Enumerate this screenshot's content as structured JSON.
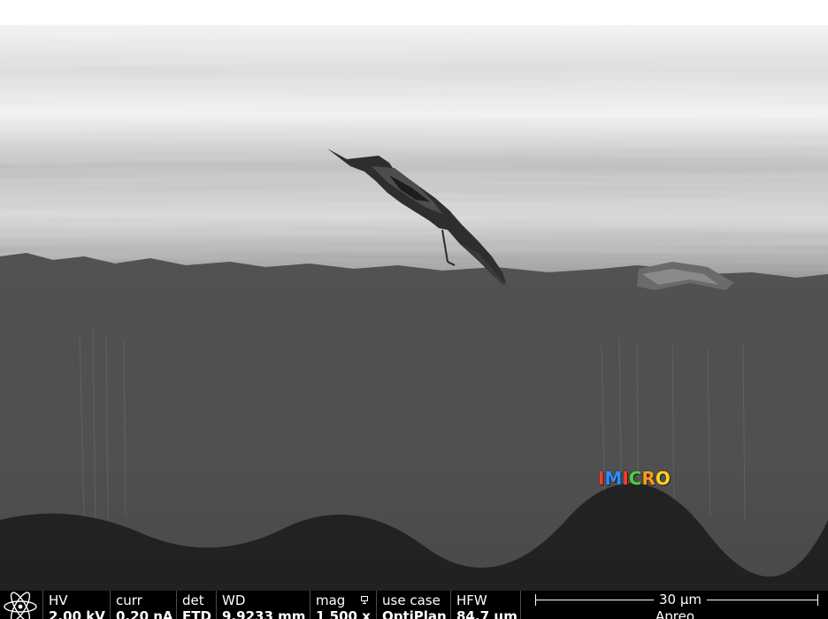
{
  "image": {
    "description_icon": "sem-micrograph",
    "subject": "bird-on-rock-surface"
  },
  "watermark": {
    "letters": [
      {
        "ch": "I",
        "color": "#ff3b2f"
      },
      {
        "ch": "M",
        "color": "#2a8cff"
      },
      {
        "ch": "I",
        "color": "#ff3b2f"
      },
      {
        "ch": "C",
        "color": "#4cd13a"
      },
      {
        "ch": "R",
        "color": "#ff9a1a"
      },
      {
        "ch": "O",
        "color": "#ffd21a"
      }
    ]
  },
  "databar": {
    "logo_icon": "atom-icon",
    "hv": {
      "label": "HV",
      "value": "2.00 kV"
    },
    "curr": {
      "label": "curr",
      "value": "0.20 nA"
    },
    "det": {
      "label": "det",
      "value": "ETD"
    },
    "wd": {
      "label": "WD",
      "value": "9.9233 mm"
    },
    "mag": {
      "label": "mag",
      "value": "1 500 x",
      "icon": "display-icon"
    },
    "use_case": {
      "label": "use case",
      "value": "OptiPlan"
    },
    "hfw": {
      "label": "HFW",
      "value": "84.7 µm"
    },
    "scale": {
      "label": "30 µm",
      "detector": "Apreo"
    }
  }
}
